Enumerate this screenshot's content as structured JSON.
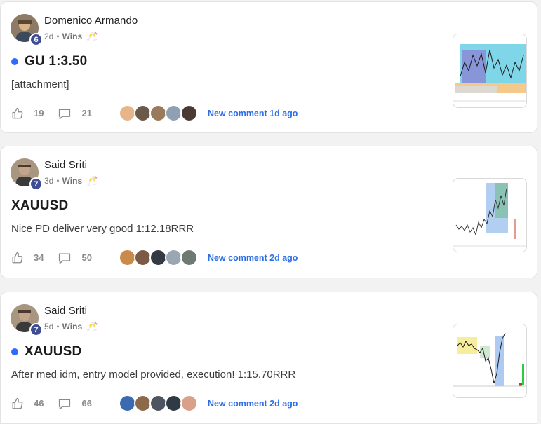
{
  "posts": [
    {
      "author": "Domenico Armando",
      "level": "6",
      "age": "2d",
      "category": "Wins",
      "emoji": "🥂",
      "unread": true,
      "title": "GU 1:3.50",
      "body": "[attachment]",
      "likes": "19",
      "comments": "21",
      "last_comment": "New comment 1d ago",
      "commenter_colors": [
        "#e8b48a",
        "#6b5a4a",
        "#9a7a5c",
        "#8fa0b5",
        "#4a3a33"
      ],
      "avatar_colors": [
        "#7a6a58",
        "#d9b58a"
      ]
    },
    {
      "author": "Said Sriti",
      "level": "7",
      "age": "3d",
      "category": "Wins",
      "emoji": "🥂",
      "unread": false,
      "title": "XAUUSD",
      "body": "Nice PD deliver very good 1:12.18RRR",
      "likes": "34",
      "comments": "50",
      "last_comment": "New comment 2d ago",
      "commenter_colors": [
        "#c98a4a",
        "#7b5a46",
        "#333a44",
        "#9aa7b2",
        "#6d7a72"
      ],
      "avatar_colors": [
        "#5a4a3e",
        "#c2a58a"
      ]
    },
    {
      "author": "Said Sriti",
      "level": "7",
      "age": "5d",
      "category": "Wins",
      "emoji": "🥂",
      "unread": true,
      "title": "XAUUSD",
      "body": "After med idm, entry model provided, execution! 1:15.70RRR",
      "likes": "46",
      "comments": "66",
      "last_comment": "New comment 2d ago",
      "commenter_colors": [
        "#3a6ab0",
        "#8a6a4a",
        "#4d5560",
        "#2f3a44",
        "#d9a08a"
      ],
      "avatar_colors": [
        "#5a4a3e",
        "#c2a58a"
      ]
    }
  ],
  "colors": {
    "accent": "#2d6ee8",
    "unread_dot": "#2f6bff",
    "level_badge": "#3f4e93"
  },
  "icons": {
    "like": "thumbs-up-icon",
    "comment": "comment-bubble-icon"
  }
}
